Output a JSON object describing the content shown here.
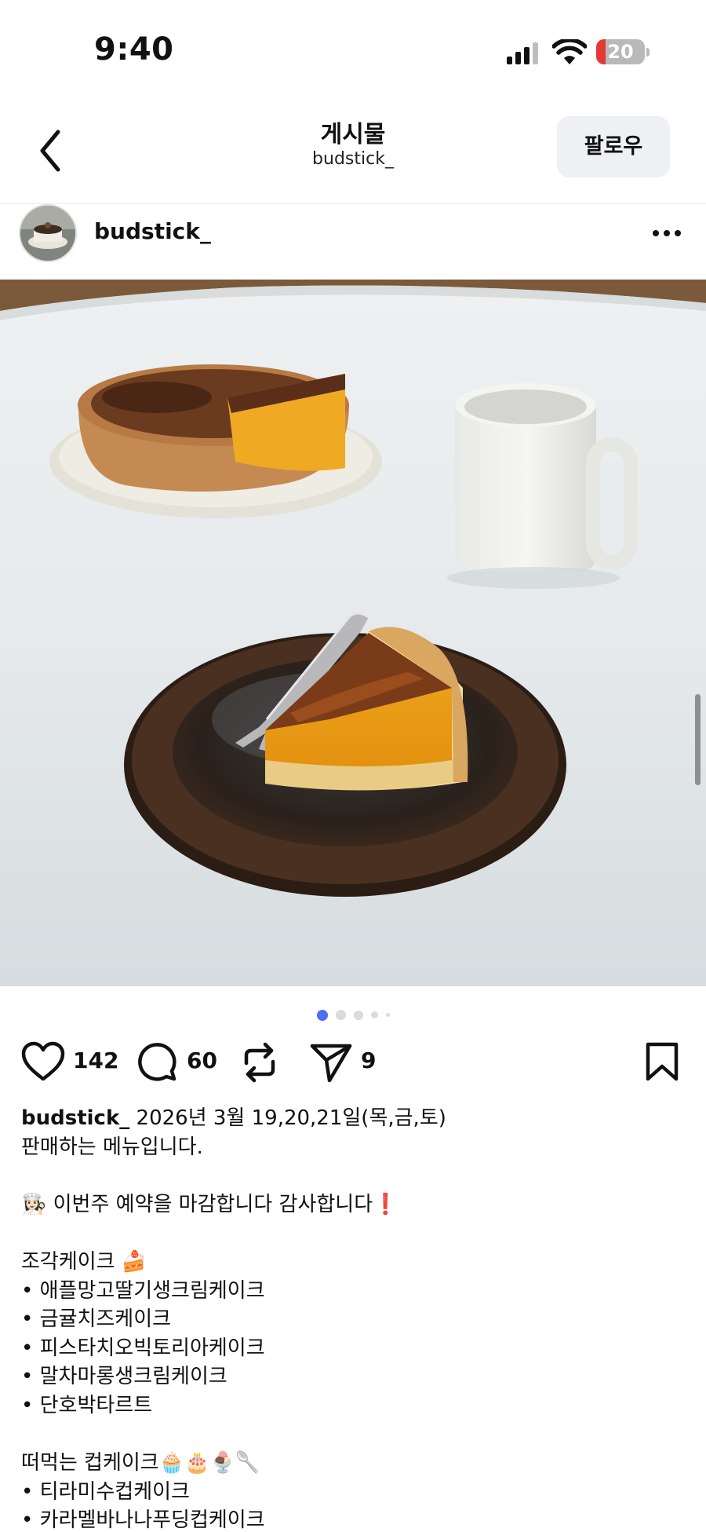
{
  "status_bar": {
    "time": "9:40",
    "battery_level": "20",
    "battery_percent": 20,
    "battery_low_color": "#e53935"
  },
  "header": {
    "back_icon": "chevron-left-icon",
    "title": "게시물",
    "subtitle": "budstick_",
    "follow_label": "팔로우"
  },
  "post": {
    "author": "budstick_",
    "more_icon": "ellipsis-icon",
    "image_count": 5,
    "active_image_index": 0
  },
  "actions": {
    "like_count": "142",
    "comment_count": "60",
    "repost_count": "",
    "share_count": "9",
    "accent_color": "#4e6cf5"
  },
  "caption": {
    "username": "budstick_",
    "line1_rest": " 2026년 3월 19,20,21일(목,금,토)",
    "line2": "판매하는 메뉴입니다.",
    "notice": "👩🏻‍🍳 이번주 예약을 마감합니다 감사합니다❗️",
    "section1_title": "조각케이크 🍰",
    "section1_items": [
      "• 애플망고딸기생크림케이크",
      "• 금귤치즈케이크",
      "• 피스타치오빅토리아케이크",
      "• 말차마롱생크림케이크",
      "• 단호박타르트"
    ],
    "section2_title": "떠먹는 컵케이크🧁🎂🍨🥄",
    "section2_items": [
      "• 티라미수컵케이크",
      "• 카라멜바나나푸딩컵케이크"
    ]
  }
}
